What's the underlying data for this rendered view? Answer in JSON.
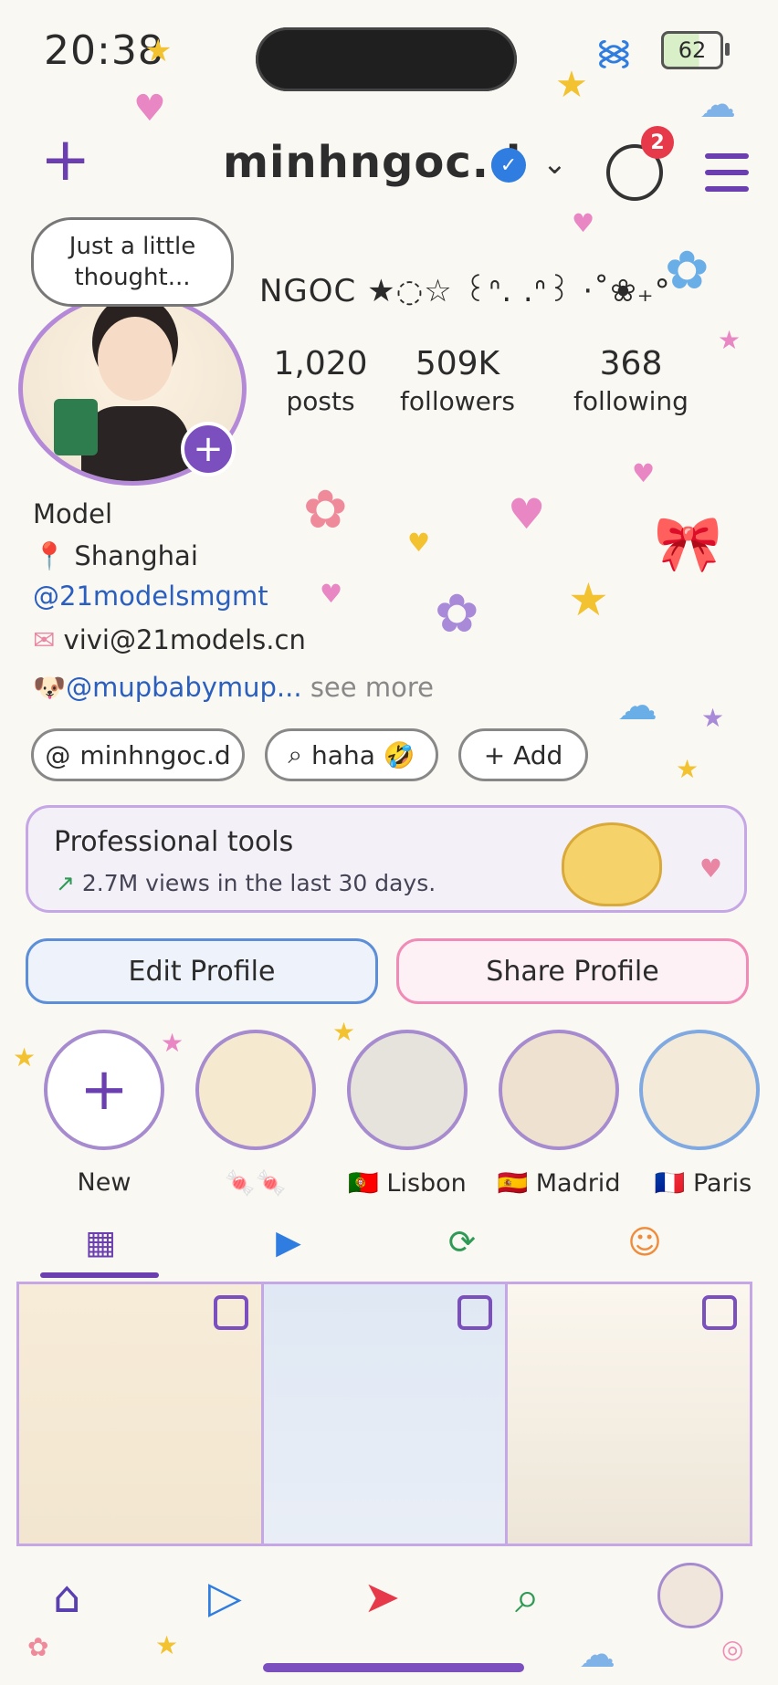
{
  "status_bar": {
    "time": "20:38",
    "battery": "62"
  },
  "header": {
    "username": "minhngoc.d",
    "notification_count": "2"
  },
  "profile": {
    "thought_bubble": "Just a little thought...",
    "display_name": "NGOC ★◌☆ ꒰ᐢ. .ᐢ꒱ ·˚❀₊°",
    "stats": [
      {
        "value": "1,020",
        "label": "posts"
      },
      {
        "value": "509K",
        "label": "followers"
      },
      {
        "value": "368",
        "label": "following"
      }
    ]
  },
  "bio": {
    "category": "Model",
    "location": "Shanghai",
    "mention": "@21modelsmgmt",
    "email": "vivi@21models.cn",
    "extra_mention": "@mupbabymup...",
    "see_more": "see more"
  },
  "pills": [
    {
      "label": "minhngoc.d",
      "icon": "threads-icon"
    },
    {
      "label": "haha 🤣",
      "icon": "search-icon"
    },
    {
      "label": "+ Add",
      "icon": "plus-icon"
    }
  ],
  "professional_tools": {
    "title": "Professional tools",
    "subtitle": "2.7M views in the last 30 days."
  },
  "buttons": {
    "edit": "Edit Profile",
    "share": "Share Profile"
  },
  "highlights": [
    {
      "label": "New"
    },
    {
      "label": "🍬🍬"
    },
    {
      "label": "🇵🇹 Lisbon"
    },
    {
      "label": "🇪🇸 Madrid"
    },
    {
      "label": "🇫🇷 Paris"
    }
  ],
  "tabs": [
    "grid-icon",
    "reels-icon",
    "reposts-icon",
    "tagged-icon"
  ],
  "bottom_nav": [
    "home-icon",
    "reels-icon",
    "send-icon",
    "search-icon",
    "profile-avatar"
  ],
  "colors": {
    "accent": "#6b3fb0",
    "link": "#2a5fc0",
    "badge": "#e6394a"
  }
}
